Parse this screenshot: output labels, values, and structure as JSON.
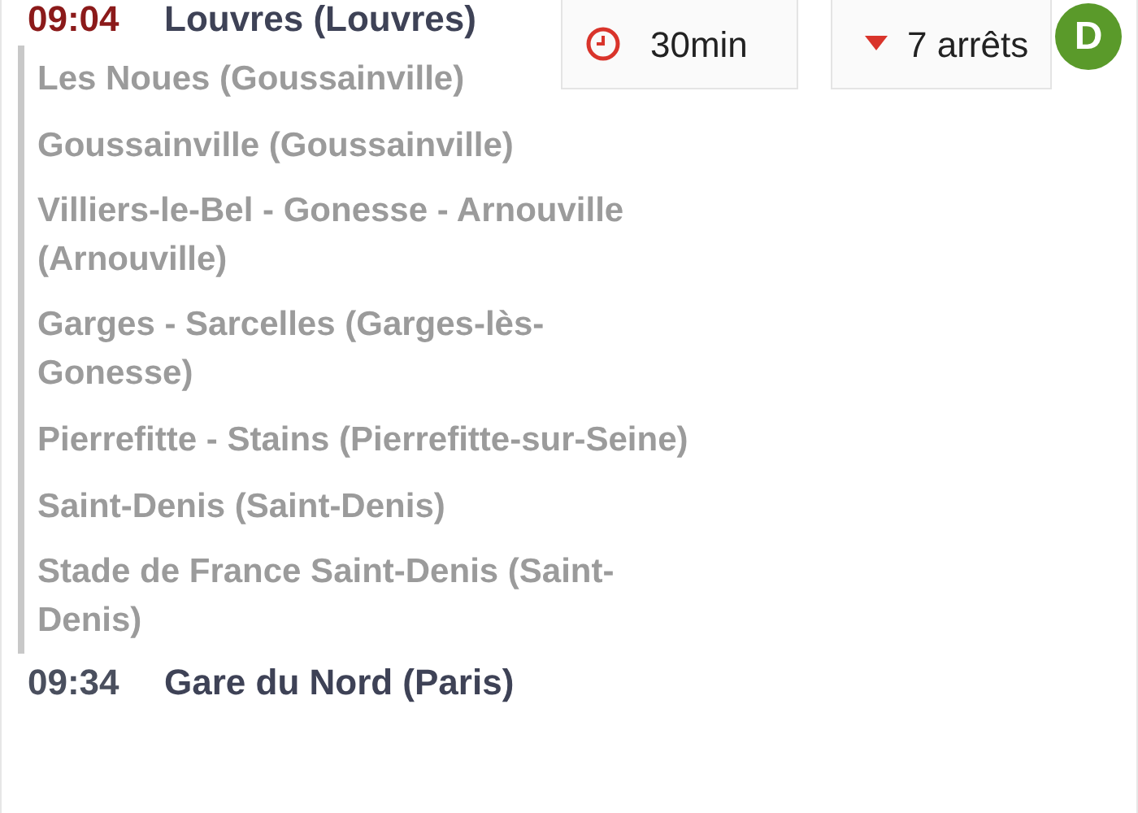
{
  "departure": {
    "time": "09:04",
    "station": "Louvres (Louvres)"
  },
  "duration": {
    "label": "30min"
  },
  "stops_toggle": {
    "label": "7 arrêts",
    "expanded": true
  },
  "avatar": {
    "letter": "D",
    "color": "#5a9a2a"
  },
  "stops": [
    {
      "name": "Les Noues (Goussainville)"
    },
    {
      "name": "Goussainville (Goussainville)"
    },
    {
      "name": "Villiers-le-Bel - Gonesse - Arnouville (Arnouville)"
    },
    {
      "name": "Garges - Sarcelles (Garges-lès-Gonesse)"
    },
    {
      "name": "Pierrefitte - Stains (Pierrefitte-sur-Seine)"
    },
    {
      "name": "Saint-Denis (Saint-Denis)"
    },
    {
      "name": "Stade de France Saint-Denis (Saint-Denis)"
    }
  ],
  "arrival": {
    "time": "09:34",
    "station": "Gare du Nord (Paris)"
  }
}
